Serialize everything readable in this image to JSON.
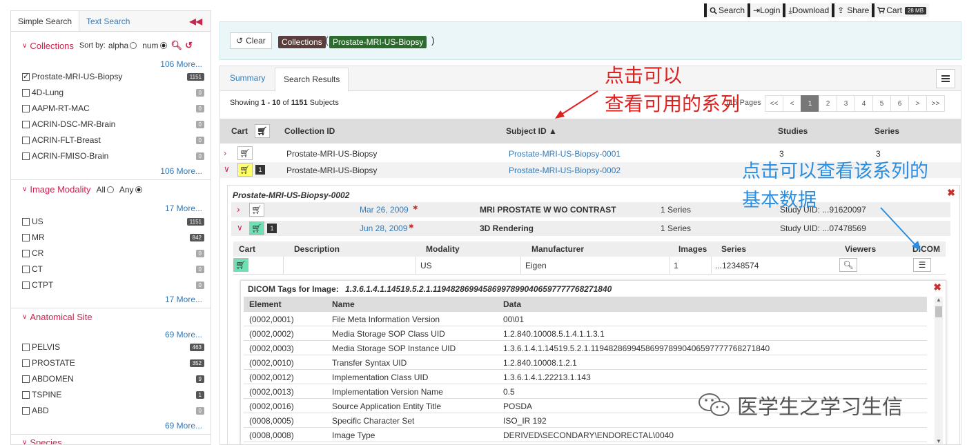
{
  "topbar": {
    "search": "Search",
    "login": "Login",
    "download": "Download",
    "share": "Share",
    "cart": "Cart",
    "cart_size": "28 MB"
  },
  "sidebar": {
    "tabs": [
      "Simple Search",
      "Text Search"
    ],
    "collections": {
      "title": "Collections",
      "sort_by": "Sort by:",
      "sort_alpha": "alpha",
      "sort_num": "num",
      "more": "106 More...",
      "items": [
        {
          "label": "Prostate-MRI-US-Biopsy",
          "count": "1151",
          "checked": true
        },
        {
          "label": "4D-Lung",
          "count": "0"
        },
        {
          "label": "AAPM-RT-MAC",
          "count": "0"
        },
        {
          "label": "ACRIN-DSC-MR-Brain",
          "count": "0"
        },
        {
          "label": "ACRIN-FLT-Breast",
          "count": "0"
        },
        {
          "label": "ACRIN-FMISO-Brain",
          "count": "0"
        }
      ]
    },
    "modality": {
      "title": "Image Modality",
      "all": "All",
      "any": "Any",
      "more": "17 More...",
      "items": [
        {
          "label": "US",
          "count": "1151"
        },
        {
          "label": "MR",
          "count": "842"
        },
        {
          "label": "CR",
          "count": "0"
        },
        {
          "label": "CT",
          "count": "0"
        },
        {
          "label": "CTPT",
          "count": "0"
        }
      ]
    },
    "anatomical": {
      "title": "Anatomical Site",
      "more": "69 More...",
      "items": [
        {
          "label": "PELVIS",
          "count": "463"
        },
        {
          "label": "PROSTATE",
          "count": "352"
        },
        {
          "label": "ABDOMEN",
          "count": "9"
        },
        {
          "label": "TSPINE",
          "count": "1"
        },
        {
          "label": "ABD",
          "count": "0"
        }
      ]
    },
    "species": {
      "title": "Species"
    }
  },
  "query": {
    "clear": "Clear",
    "tag1": "Collections",
    "open_paren": "(",
    "tag2": "Prostate-MRI-US-Biopsy",
    "close_paren": ")"
  },
  "main": {
    "tabs": [
      "Summary",
      "Search Results"
    ],
    "showing_prefix": "Showing ",
    "showing_range": "1 - 10",
    "showing_of": " of ",
    "showing_total": "1151",
    "showing_suffix": " Subjects",
    "pager_hidden": "115 Pages",
    "pager": [
      "<<",
      "<",
      "1",
      "2",
      "3",
      "4",
      "5",
      "6",
      ">",
      ">>"
    ],
    "columns": [
      "Cart",
      "Collection ID",
      "Subject ID",
      "Studies",
      "Series"
    ],
    "rows": [
      {
        "collection": "Prostate-MRI-US-Biopsy",
        "subject": "Prostate-MRI-US-Biopsy-0001",
        "studies": "3",
        "series": "3"
      },
      {
        "collection": "Prostate-MRI-US-Biopsy",
        "subject": "Prostate-MRI-US-Biopsy-0002",
        "badge": "1"
      }
    ]
  },
  "detail": {
    "subject": "Prostate-MRI-US-Biopsy-0002",
    "studies": [
      {
        "date": "Mar 26, 2009",
        "desc": "MRI PROSTATE W WO CONTRAST",
        "series": "1 Series",
        "uid": "Study UID: ...91620097"
      },
      {
        "date": "Jun 28, 2009",
        "desc": "3D Rendering",
        "series": "1 Series",
        "uid": "Study UID: ...07478569",
        "badge": "1"
      }
    ],
    "series_columns": [
      "Cart",
      "Description",
      "Modality",
      "Manufacturer",
      "Images",
      "Series",
      "Viewers",
      "DICOM"
    ],
    "series_row": {
      "modality": "US",
      "manufacturer": "Eigen",
      "images": "1",
      "series": "...12348574"
    },
    "tags": {
      "title_prefix": "DICOM Tags for Image:",
      "image_uid": "1.3.6.1.4.1.14519.5.2.1.119482869945869978990406597777768271840",
      "columns": [
        "Element",
        "Name",
        "Data"
      ],
      "rows": [
        {
          "element": "(0002,0001)",
          "name": "File Meta Information Version",
          "data": "00\\01"
        },
        {
          "element": "(0002,0002)",
          "name": "Media Storage SOP Class UID",
          "data": "1.2.840.10008.5.1.4.1.1.3.1"
        },
        {
          "element": "(0002,0003)",
          "name": "Media Storage SOP Instance UID",
          "data": "1.3.6.1.4.1.14519.5.2.1.119482869945869978990406597777768271840"
        },
        {
          "element": "(0002,0010)",
          "name": "Transfer Syntax UID",
          "data": "1.2.840.10008.1.2.1"
        },
        {
          "element": "(0002,0012)",
          "name": "Implementation Class UID",
          "data": "1.3.6.1.4.1.22213.1.143"
        },
        {
          "element": "(0002,0013)",
          "name": "Implementation Version Name",
          "data": "0.5"
        },
        {
          "element": "(0002,0016)",
          "name": "Source Application Entity Title",
          "data": "POSDA"
        },
        {
          "element": "(0008,0005)",
          "name": "Specific Character Set",
          "data": "ISO_IR 192"
        },
        {
          "element": "(0008,0008)",
          "name": "Image Type",
          "data": "DERIVED\\SECONDARY\\ENDORECTAL\\0040"
        }
      ]
    }
  },
  "annotations": {
    "red_line1": "点击可以",
    "red_line2": "查看可用的系列",
    "blue_line1": "点击可以查看该系列的",
    "blue_line2": "基本数据",
    "watermark": "医学生之学习生信"
  },
  "colors": {
    "accent_red": "#c7254e",
    "link_blue": "#337ab7",
    "tag_collections": "#5a3e3e",
    "tag_collection_value": "#2d6a2d",
    "cart_yellow": "#ffff66",
    "cart_green": "#6ee0b4",
    "annotation_red": "#e0201f",
    "annotation_blue": "#2a8de0"
  }
}
